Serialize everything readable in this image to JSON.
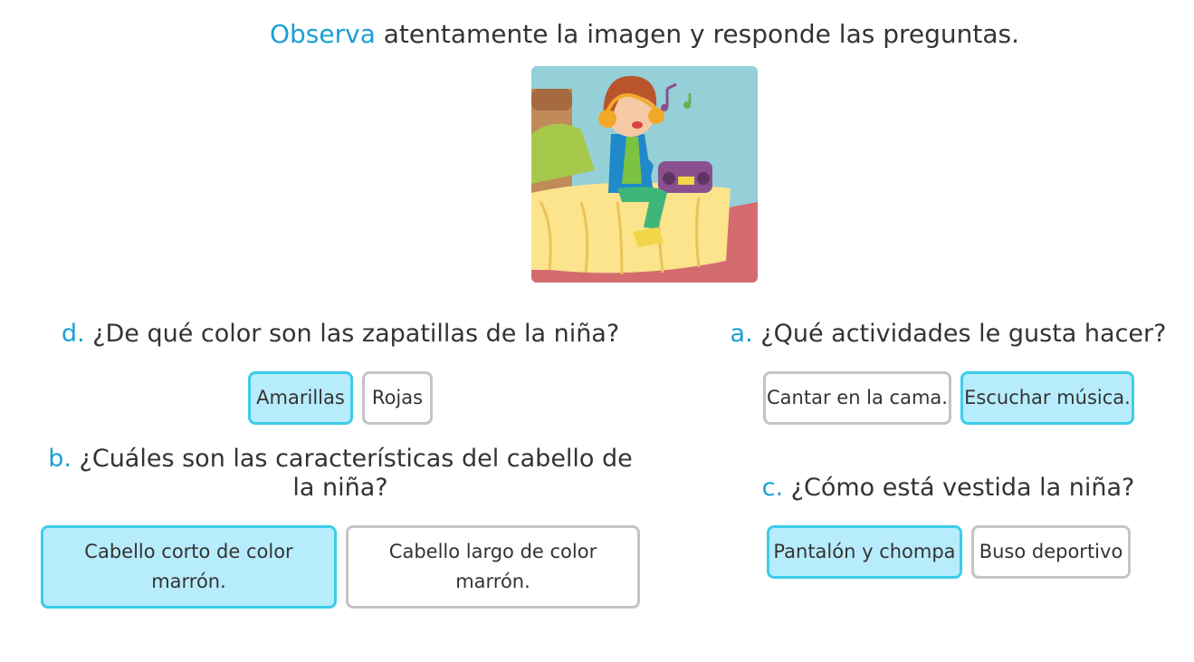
{
  "instruction": {
    "highlight": "Observa",
    "rest": " atentamente la imagen y responde las preguntas."
  },
  "illustration": {
    "icon": "girl-listening-music-illustration"
  },
  "questions": {
    "d": {
      "letter": "d.",
      "text": " ¿De qué color son las zapatillas de la niña?",
      "options": [
        {
          "label": "Amarillas",
          "selected": true
        },
        {
          "label": "Rojas",
          "selected": false
        }
      ]
    },
    "a": {
      "letter": "a.",
      "text": " ¿Qué actividades le gusta hacer?",
      "options": [
        {
          "label": "Cantar en la cama.",
          "selected": false
        },
        {
          "label": "Escuchar música.",
          "selected": true
        }
      ]
    },
    "b": {
      "letter": "b.",
      "text": " ¿Cuáles son las características del cabello de la niña?",
      "options": [
        {
          "label": "Cabello corto de color marrón.",
          "selected": true
        },
        {
          "label": "Cabello largo de color marrón.",
          "selected": false
        }
      ]
    },
    "c": {
      "letter": "c.",
      "text": " ¿Cómo está vestida la niña?",
      "options": [
        {
          "label": "Pantalón y chompa",
          "selected": true
        },
        {
          "label": "Buso deportivo",
          "selected": false
        }
      ]
    }
  },
  "colors": {
    "accent": "#1a9fd6",
    "selected_bg": "#b7ecfc",
    "selected_border": "#3ccde9",
    "default_border": "#c4c4c4"
  }
}
